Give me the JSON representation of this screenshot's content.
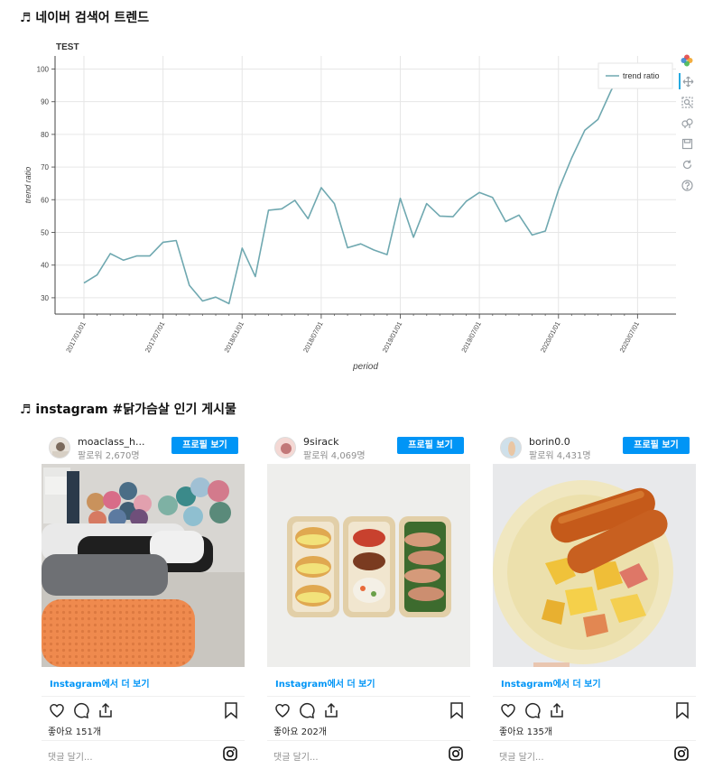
{
  "section1": {
    "title": "♬ 네이버 검색어 트렌드"
  },
  "section2": {
    "title": "♬ instagram #닭가슴살 인기 게시물"
  },
  "chart_data": {
    "type": "line",
    "title": "TEST",
    "xlabel": "period",
    "ylabel": "trend ratio",
    "ylim": [
      25,
      104
    ],
    "yticks": [
      30,
      40,
      50,
      60,
      70,
      80,
      90,
      100
    ],
    "xticks": [
      "2017/01/01",
      "2017/07/01",
      "2018/01/01",
      "2018/07/01",
      "2019/01/01",
      "2019/07/01",
      "2020/01/01",
      "2020/07/01"
    ],
    "x_months": [
      0,
      1,
      2,
      3,
      4,
      5,
      6,
      7,
      8,
      9,
      10,
      11,
      12,
      13,
      14,
      15,
      16,
      17,
      18,
      19,
      20,
      21,
      22,
      23,
      24,
      25,
      26,
      27,
      28,
      29,
      30,
      31,
      32,
      33,
      34,
      35,
      36,
      37,
      38,
      39,
      40,
      41
    ],
    "x_start": "2017/01",
    "legend": {
      "position": "top-right"
    },
    "grid": true,
    "series": [
      {
        "name": "trend ratio",
        "color": "#6fa8b0",
        "values": [
          34.5,
          37,
          43.5,
          41.5,
          42.8,
          42.8,
          47,
          47.5,
          33.8,
          29,
          30.2,
          28.2,
          45.2,
          36.5,
          56.8,
          57.2,
          59.8,
          54.2,
          63.7,
          58.8,
          45.3,
          46.5,
          44.6,
          43.2,
          60.4,
          48.5,
          58.8,
          55,
          54.8,
          59.5,
          62.2,
          60.7,
          53.3,
          55.3,
          49.2,
          50.4,
          63,
          72.8,
          81.3,
          84.6,
          93.5,
          100
        ]
      }
    ]
  },
  "toolbar": {
    "items": [
      "bokeh-logo-icon",
      "pan-icon",
      "box-zoom-icon",
      "wheel-zoom-icon",
      "save-icon",
      "reset-icon",
      "help-icon"
    ]
  },
  "posts": [
    {
      "username": "moaclass_h...",
      "followers": "팔로워 2,670명",
      "follow_label": "프로필 보기",
      "more_label": "Instagram에서 더 보기",
      "likes": "좋아요 151개",
      "comment_placeholder": "댓글 달기..."
    },
    {
      "username": "9sirack",
      "followers": "팔로워 4,069명",
      "follow_label": "프로필 보기",
      "more_label": "Instagram에서 더 보기",
      "likes": "좋아요 202개",
      "comment_placeholder": "댓글 달기..."
    },
    {
      "username": "borin0.0",
      "followers": "팔로워 4,431명",
      "follow_label": "프로필 보기",
      "more_label": "Instagram에서 더 보기",
      "likes": "좋아요 135개",
      "comment_placeholder": "댓글 달기..."
    }
  ]
}
